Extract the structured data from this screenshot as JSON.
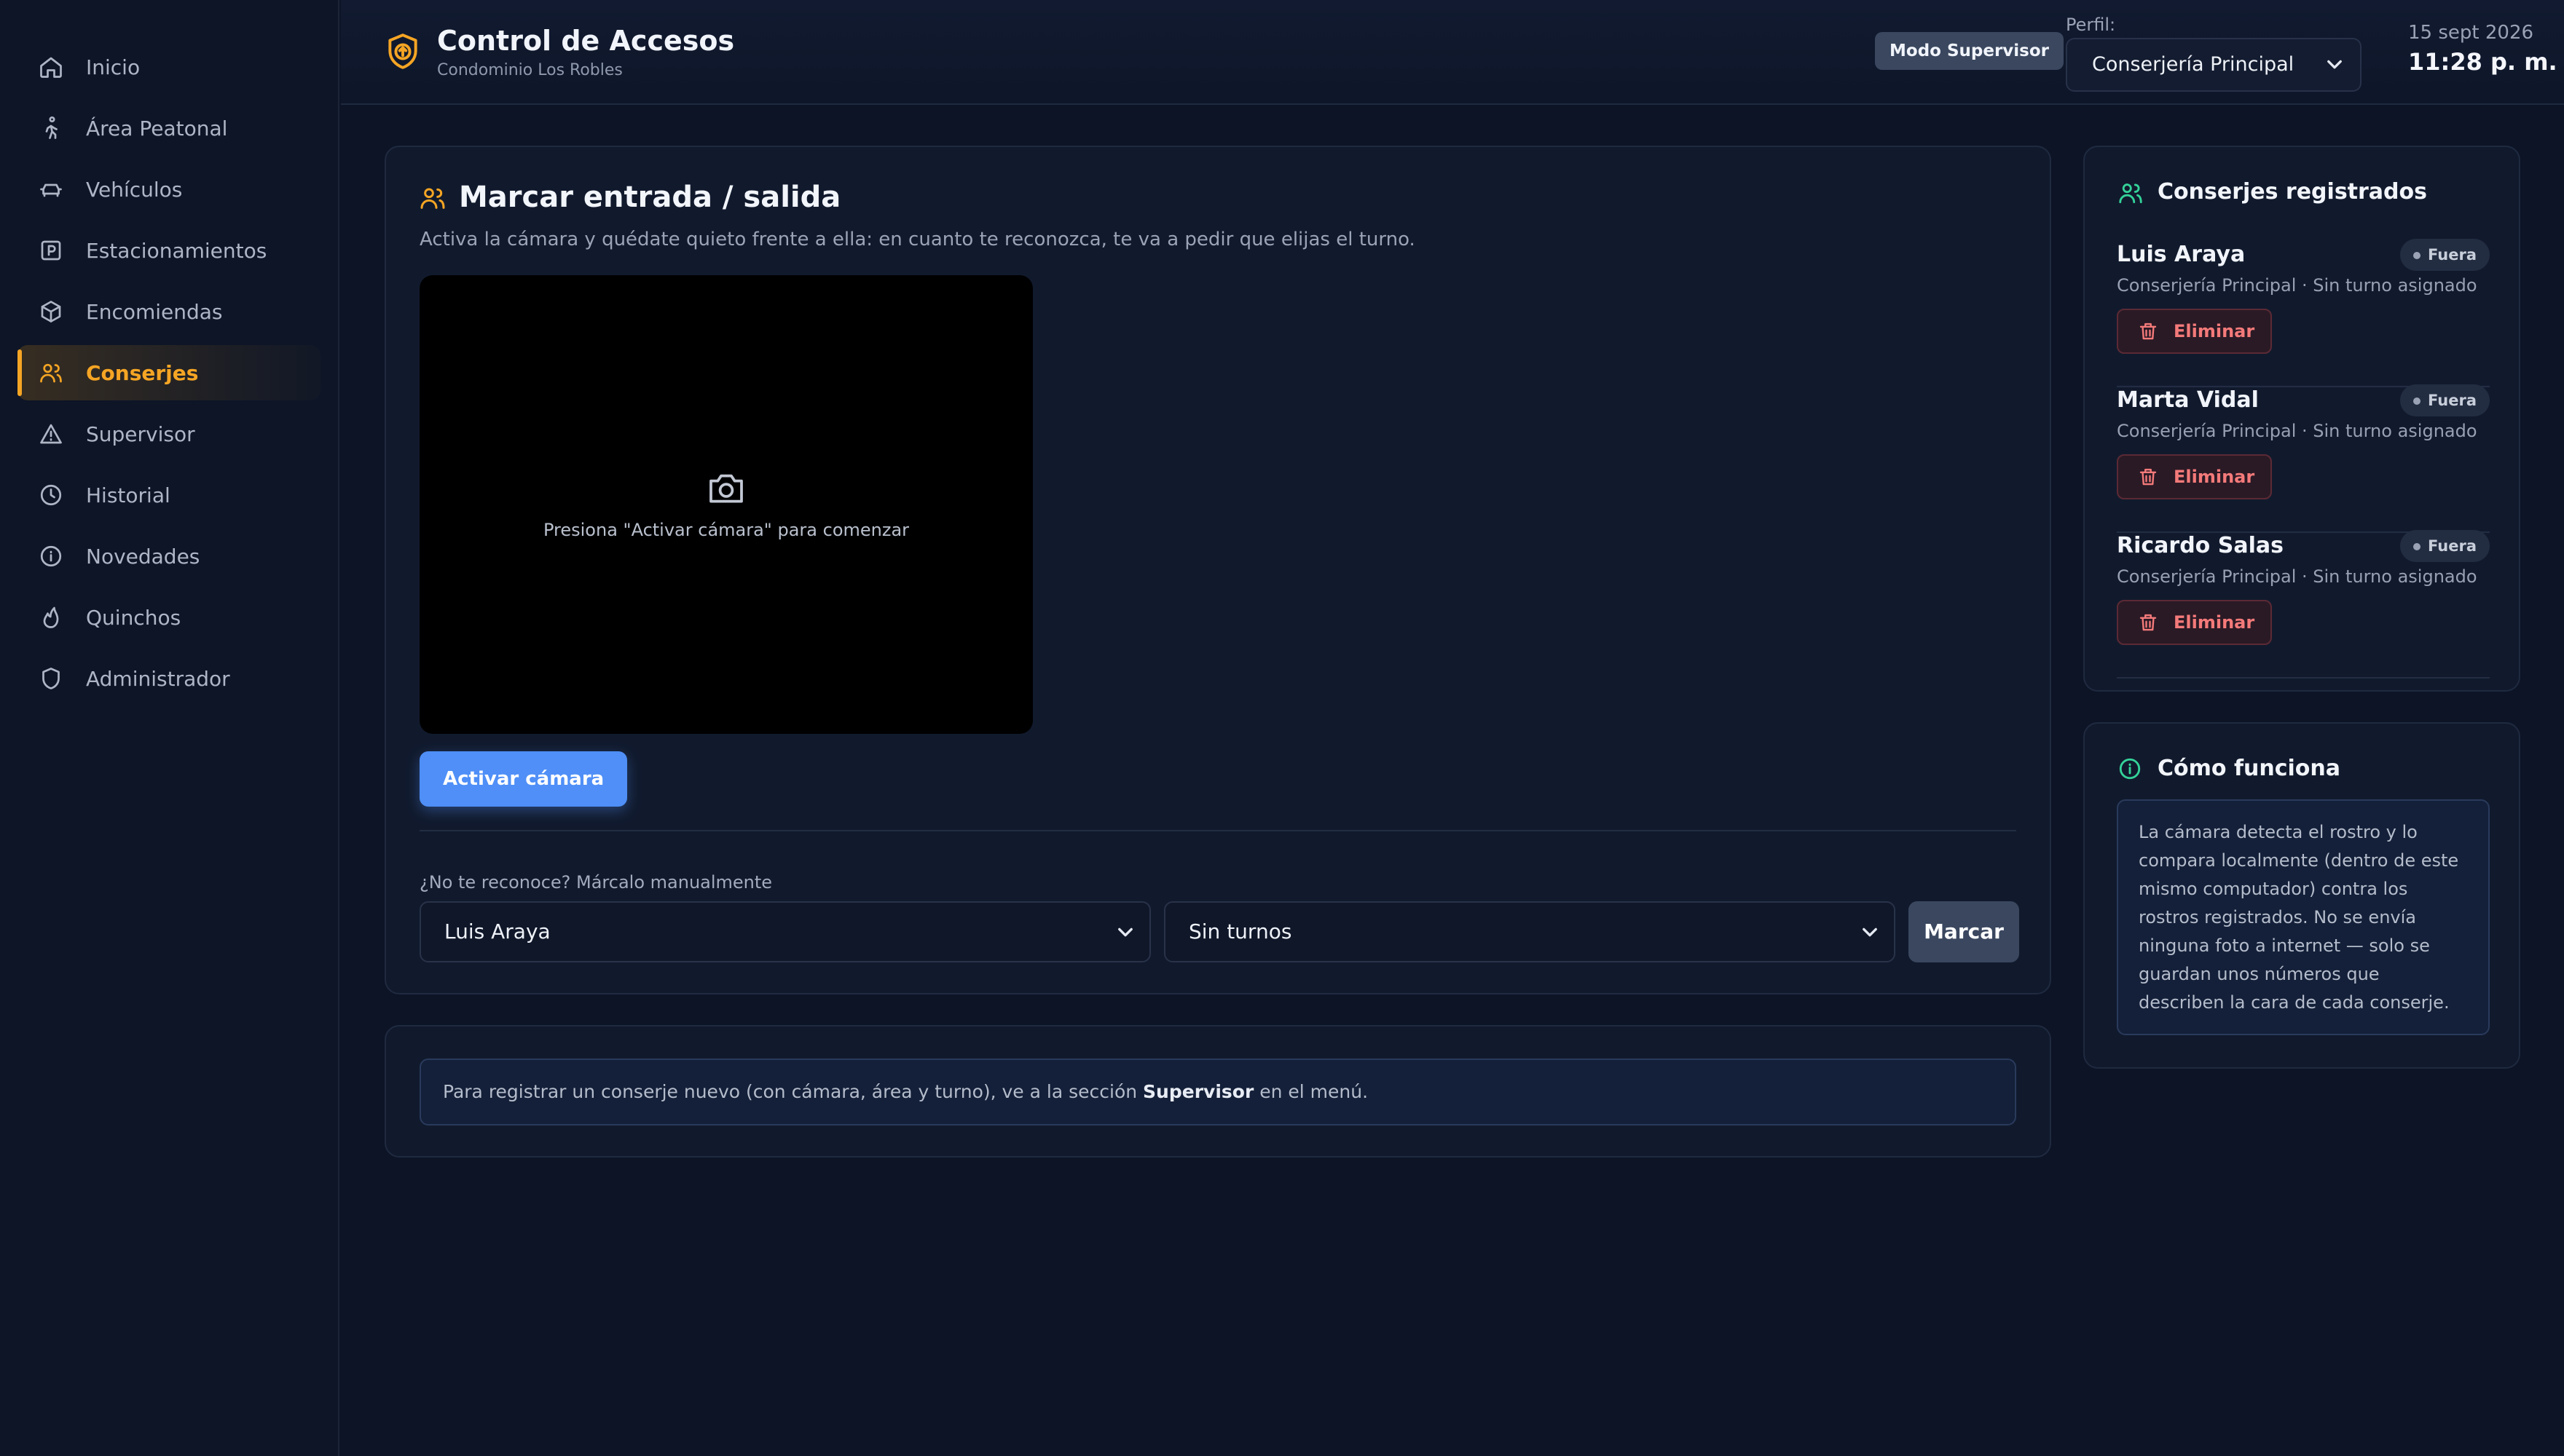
{
  "sidebar": {
    "items": [
      {
        "label": "Inicio",
        "icon": "home-icon"
      },
      {
        "label": "Área Peatonal",
        "icon": "walking-icon"
      },
      {
        "label": "Vehículos",
        "icon": "car-icon"
      },
      {
        "label": "Estacionamientos",
        "icon": "parking-icon"
      },
      {
        "label": "Encomiendas",
        "icon": "package-icon"
      },
      {
        "label": "Conserjes",
        "icon": "users-icon"
      },
      {
        "label": "Supervisor",
        "icon": "warning-icon"
      },
      {
        "label": "Historial",
        "icon": "clock-icon"
      },
      {
        "label": "Novedades",
        "icon": "info-icon"
      },
      {
        "label": "Quinchos",
        "icon": "flame-icon"
      },
      {
        "label": "Administrador",
        "icon": "shield-icon"
      }
    ],
    "active": "Conserjes"
  },
  "header": {
    "title": "Control de Accesos",
    "subtitle": "Condominio Los Robles",
    "mode_badge": "Modo Supervisor",
    "profile_label": "Perfil:",
    "profile_value": "Conserjería Principal",
    "date": "15 sept 2026",
    "time": "11:28 p. m."
  },
  "main": {
    "title": "Marcar entrada / salida",
    "description": "Activa la cámara y quédate quieto frente a ella: en cuanto te reconozca, te va a pedir que elijas el turno.",
    "camera_placeholder": "Presiona \"Activar cámara\" para comenzar",
    "activate_button": "Activar cámara",
    "manual_label": "¿No te reconoce? Márcalo manualmente",
    "guard_select_value": "Luis Araya",
    "shift_select_value": "Sin turnos",
    "mark_button": "Marcar"
  },
  "info": {
    "text_before": "Para registrar un conserje nuevo (con cámara, área y turno), ve a la sección ",
    "text_bold": "Supervisor",
    "text_after": " en el menú."
  },
  "guards": {
    "title": "Conserjes registrados",
    "items": [
      {
        "name": "Luis Araya",
        "status": "Fuera",
        "detail": "Conserjería Principal · Sin turno asignado",
        "delete_label": "Eliminar"
      },
      {
        "name": "Marta Vidal",
        "status": "Fuera",
        "detail": "Conserjería Principal · Sin turno asignado",
        "delete_label": "Eliminar"
      },
      {
        "name": "Ricardo Salas",
        "status": "Fuera",
        "detail": "Conserjería Principal · Sin turno asignado",
        "delete_label": "Eliminar"
      }
    ]
  },
  "how": {
    "title": "Cómo funciona",
    "text": "La cámara detecta el rostro y lo compara localmente (dentro de este mismo computador) contra los rostros registrados. No se envía ninguna foto a internet — solo se guardan unos números que describen la cara de cada conserje."
  },
  "colors": {
    "accent": "#f5a524",
    "primary": "#4f8ff7",
    "danger": "#f47a7a",
    "success": "#34d399",
    "background": "#0c1426"
  }
}
